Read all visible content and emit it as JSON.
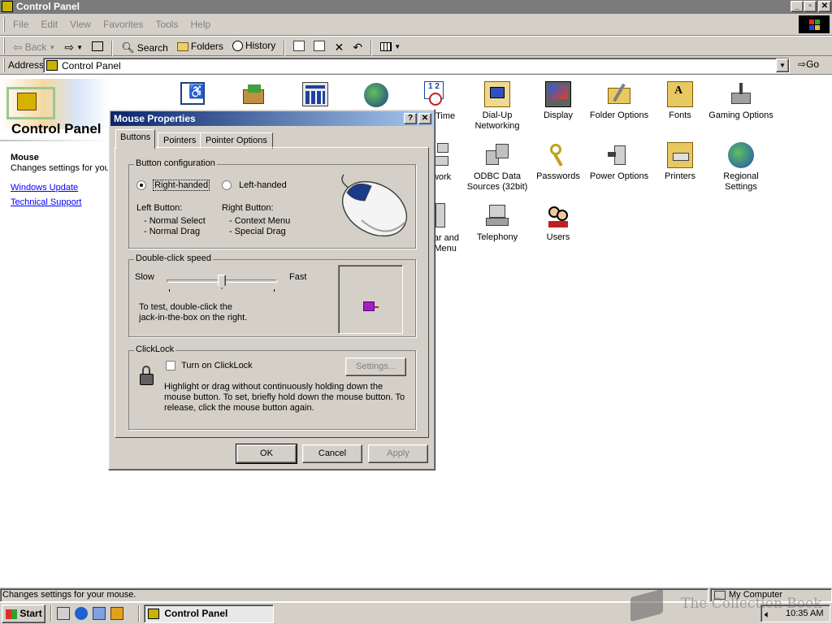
{
  "window": {
    "title": "Control Panel"
  },
  "menu": [
    "File",
    "Edit",
    "View",
    "Favorites",
    "Tools",
    "Help"
  ],
  "toolbar": {
    "back": "Back",
    "search": "Search",
    "folders": "Folders",
    "history": "History"
  },
  "address": {
    "label": "Address",
    "value": "Control Panel",
    "go": "Go"
  },
  "left_panel": {
    "title": "Control Panel",
    "item_title": "Mouse",
    "item_desc": "Changes settings for your mouse.",
    "links": [
      "Windows Update",
      "Technical Support"
    ]
  },
  "icons": [
    {
      "label": "Date/Time"
    },
    {
      "label": "Dial-Up Networking"
    },
    {
      "label": "Display"
    },
    {
      "label": "Folder Options"
    },
    {
      "label": "Fonts"
    },
    {
      "label": "Gaming Options"
    },
    {
      "label": "Network"
    },
    {
      "label": "ODBC Data Sources (32bit)"
    },
    {
      "label": "Passwords"
    },
    {
      "label": "Power Options"
    },
    {
      "label": "Printers"
    },
    {
      "label": "Regional Settings"
    },
    {
      "label": "Taskbar and Start Menu"
    },
    {
      "label": "Telephony"
    },
    {
      "label": "Users"
    }
  ],
  "dialog": {
    "title": "Mouse Properties",
    "tabs": [
      "Buttons",
      "Pointers",
      "Pointer Options"
    ],
    "button_config": {
      "label": "Button configuration",
      "right_handed": "Right-handed",
      "left_handed": "Left-handed",
      "left_button_title": "Left Button:",
      "left_button_items": [
        "- Normal Select",
        "- Normal Drag"
      ],
      "right_button_title": "Right Button:",
      "right_button_items": [
        "- Context Menu",
        "- Special Drag"
      ],
      "selected": "Right-handed"
    },
    "double_click": {
      "label": "Double-click speed",
      "slow": "Slow",
      "fast": "Fast",
      "speed_fraction": 0.5,
      "test_text_1": "To test, double-click the",
      "test_text_2": "jack-in-the-box on the right."
    },
    "clicklock": {
      "label": "ClickLock",
      "checkbox": "Turn on ClickLock",
      "checked": false,
      "settings": "Settings...",
      "desc": "Highlight or drag without continuously holding down the mouse button. To set, briefly hold down the mouse button. To release, click the mouse button again."
    },
    "buttons": {
      "ok": "OK",
      "cancel": "Cancel",
      "apply": "Apply"
    }
  },
  "status": {
    "text": "Changes settings for your mouse.",
    "zone": "My Computer"
  },
  "taskbar": {
    "start": "Start",
    "task": "Control Panel",
    "time": "10:35 AM"
  },
  "watermark": "The Collection Book"
}
